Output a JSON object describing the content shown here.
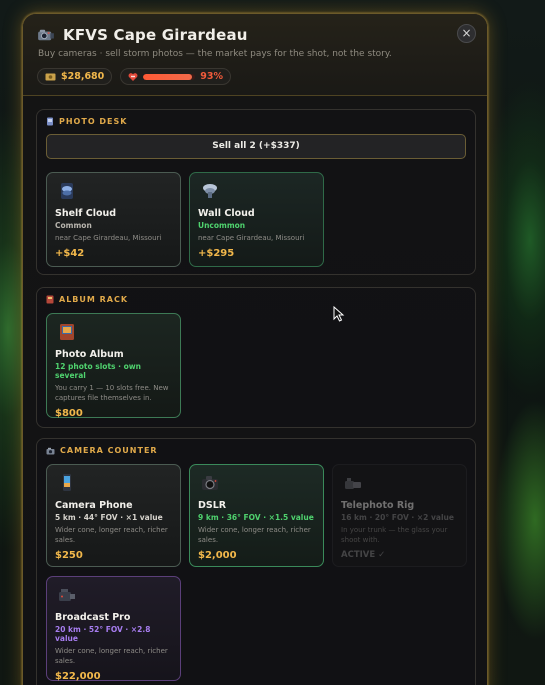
{
  "window": {
    "title": "KFVS Cape Girardeau",
    "subtitle": "Buy cameras · sell storm photos — the market pays for the shot, not the story.",
    "close_symbol": "×"
  },
  "stats": {
    "money": "$28,680",
    "battery_percent": 93,
    "battery_label": "93%"
  },
  "photo_desk": {
    "title": "PHOTO DESK",
    "sell_all_label": "Sell all 2 (+$337)",
    "photos": [
      {
        "name": "Shelf Cloud",
        "rarity": "Common",
        "location": "near Cape Girardeau, Missouri",
        "price": "+$42",
        "rarity_color": "#b7b4ad"
      },
      {
        "name": "Wall Cloud",
        "rarity": "Uncommon",
        "location": "near Cape Girardeau, Missouri",
        "price": "+$295",
        "rarity_color": "#4fd26e"
      }
    ]
  },
  "album_rack": {
    "title": "ALBUM RACK",
    "items": [
      {
        "name": "Photo Album",
        "sub": "12 photo slots · own several",
        "desc": "You carry 1 — 10 slots free. New captures file themselves in.",
        "price": "$800"
      }
    ]
  },
  "camera_counter": {
    "title": "CAMERA COUNTER",
    "cameras": [
      {
        "name": "Camera Phone",
        "specs": "5 km · 44° FOV · ×1 value",
        "desc": "Wider cone, longer reach, richer sales.",
        "price": "$250",
        "spec_color": "#d6d3cc"
      },
      {
        "name": "DSLR",
        "specs": "9 km · 36° FOV · ×1.5 value",
        "desc": "Wider cone, longer reach, richer sales.",
        "price": "$2,000",
        "spec_color": "#4fd26e"
      },
      {
        "name": "Telephoto Rig",
        "specs": "16 km · 20° FOV · ×2 value",
        "desc": "In your trunk — the glass your shoot with.",
        "price": "ACTIVE ✓",
        "spec_color": "#8a8a8a"
      },
      {
        "name": "Broadcast Pro",
        "specs": "20 km · 52° FOV · ×2.8 value",
        "desc": "Wider cone, longer reach, richer sales.",
        "price": "$22,000",
        "spec_color": "#a77df0"
      }
    ]
  }
}
